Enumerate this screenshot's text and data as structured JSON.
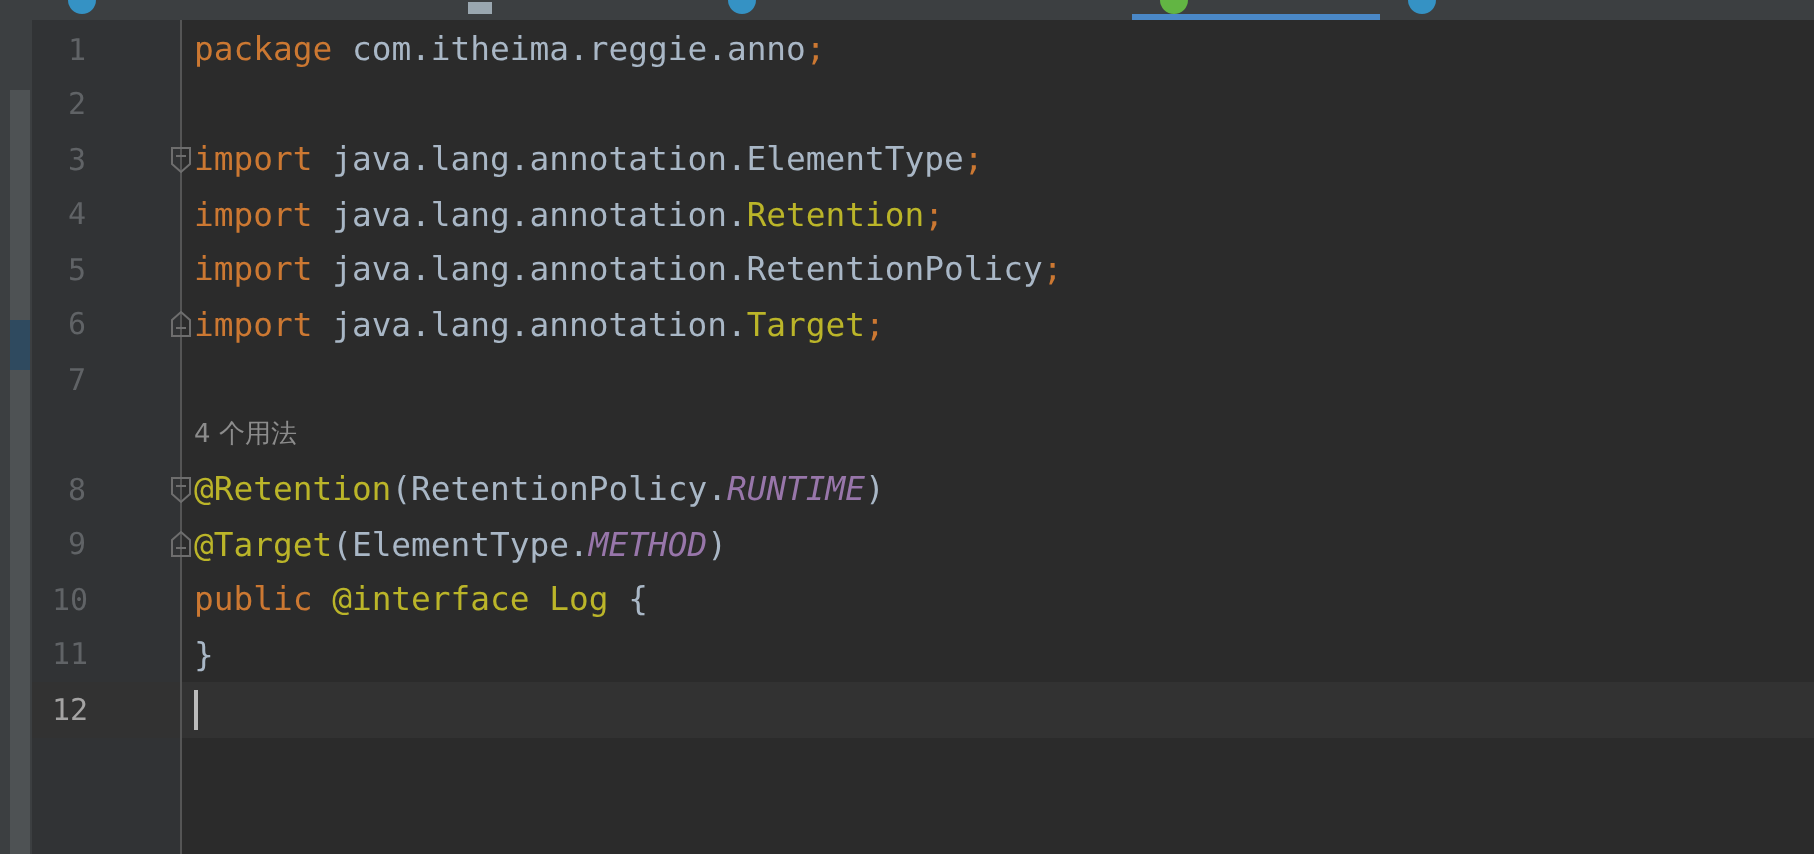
{
  "tabs": [
    {
      "kind": "class",
      "selected": false
    },
    {
      "kind": "file",
      "selected": false
    },
    {
      "kind": "class",
      "selected": false
    },
    {
      "kind": "annotation",
      "selected": true
    },
    {
      "kind": "class",
      "selected": false
    }
  ],
  "editor": {
    "lines": [
      {
        "kind": "code",
        "number": "1",
        "current": false,
        "tokens": [
          {
            "kind": "keyword",
            "text": "package "
          },
          {
            "kind": "plain",
            "text": "com.itheima.reggie.anno"
          },
          {
            "kind": "keyword",
            "text": ";"
          }
        ]
      },
      {
        "kind": "code",
        "number": "2",
        "current": false
      },
      {
        "kind": "code",
        "number": "3",
        "current": false,
        "fold_start": true,
        "tokens": [
          {
            "kind": "keyword",
            "text": "import "
          },
          {
            "kind": "plain",
            "text": "java.lang.annotation.ElementType"
          },
          {
            "kind": "keyword",
            "text": ";"
          }
        ]
      },
      {
        "kind": "code",
        "number": "4",
        "current": false,
        "tokens": [
          {
            "kind": "keyword",
            "text": "import "
          },
          {
            "kind": "plain",
            "text": "java.lang.annotation."
          },
          {
            "kind": "annotation",
            "text": "Retention"
          },
          {
            "kind": "keyword",
            "text": ";"
          }
        ]
      },
      {
        "kind": "code",
        "number": "5",
        "current": false,
        "tokens": [
          {
            "kind": "keyword",
            "text": "import "
          },
          {
            "kind": "plain",
            "text": "java.lang.annotation.RetentionPolicy"
          },
          {
            "kind": "keyword",
            "text": ";"
          }
        ]
      },
      {
        "kind": "code",
        "number": "6",
        "current": false,
        "fold_end": true,
        "tokens": [
          {
            "kind": "keyword",
            "text": "import "
          },
          {
            "kind": "plain",
            "text": "java.lang.annotation."
          },
          {
            "kind": "annotation",
            "text": "Target"
          },
          {
            "kind": "keyword",
            "text": ";"
          }
        ]
      },
      {
        "kind": "code",
        "number": "7",
        "current": false
      },
      {
        "kind": "hint",
        "text": "4 个用法"
      },
      {
        "kind": "code",
        "number": "8",
        "current": false,
        "fold_start": true,
        "tokens": [
          {
            "kind": "annotation",
            "text": "@Retention"
          },
          {
            "kind": "plain",
            "text": "(RetentionPolicy."
          },
          {
            "kind": "constant",
            "text": "RUNTIME"
          },
          {
            "kind": "plain",
            "text": ")"
          }
        ]
      },
      {
        "kind": "code",
        "number": "9",
        "current": false,
        "fold_end": true,
        "tokens": [
          {
            "kind": "annotation",
            "text": "@Target"
          },
          {
            "kind": "plain",
            "text": "(ElementType."
          },
          {
            "kind": "constant",
            "text": "METHOD"
          },
          {
            "kind": "plain",
            "text": ")"
          }
        ]
      },
      {
        "kind": "code",
        "number": "10",
        "current": false,
        "tokens": [
          {
            "kind": "keyword",
            "text": "public "
          },
          {
            "kind": "annotation",
            "text": "@interface "
          },
          {
            "kind": "annotation",
            "text": "Log "
          },
          {
            "kind": "plain",
            "text": "{"
          }
        ]
      },
      {
        "kind": "code",
        "number": "11",
        "current": false,
        "tokens": [
          {
            "kind": "plain",
            "text": "}"
          }
        ]
      },
      {
        "kind": "code",
        "number": "12",
        "current": true
      }
    ]
  }
}
